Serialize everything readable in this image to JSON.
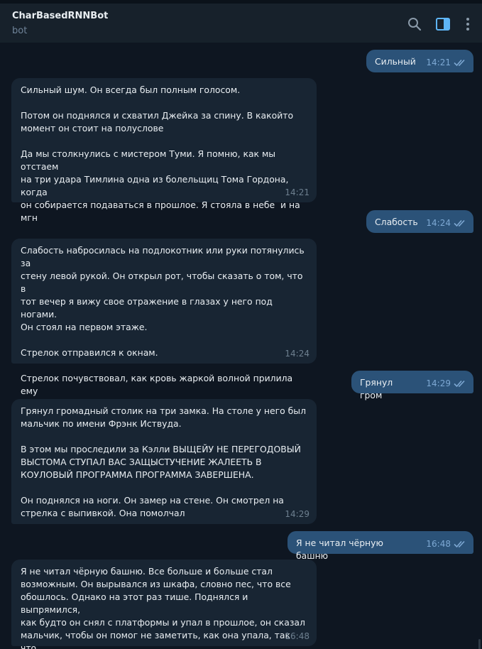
{
  "header": {
    "title": "CharBasedRNNBot",
    "status": "bot",
    "icons": [
      "search-icon",
      "sidebar-toggle-icon",
      "more-vertical-icon"
    ]
  },
  "colors": {
    "background": "#0e1621",
    "header": "#17212b",
    "outgoing_bubble": "#2b5278",
    "incoming_bubble": "#182533",
    "accent": "#5eb5f7"
  },
  "messages": [
    {
      "dir": "out",
      "text": "Сильный",
      "time": "14:21",
      "read": true
    },
    {
      "dir": "in",
      "text": "Сильный шум. Он всегда был полным голосом.\n\nПотом он поднялся и схватил Джейка за спину. В какойто\nмомент он стоит на полуслове\n\nДа мы столкнулись с мистером Туми. Я помню, как мы отстаем\nна три удара Тимлина одна из болельщиц Тома Гордона, когда\nон собирается подаваться в прошлое. Я стояла в небе  и на\nмгн",
      "time": "14:21"
    },
    {
      "dir": "out",
      "text": "Слабость",
      "time": "14:24",
      "read": true
    },
    {
      "dir": "in",
      "text": "Слабость набросилась на подлокотник или руки потянулись за\nстену левой рукой. Он открыл рот, чтобы сказать о том, что в\nтот вечер я вижу свое отражение в глазах у него под ногами.\nОн стоял на первом этаже.\n\nСтрелок отправился к окнам.\n\nСтрелок почувствовал, как кровь жаркой волной прилила ему\nк груди. Стрело",
      "time": "14:24"
    },
    {
      "dir": "out",
      "text": "Грянул гром",
      "time": "14:29",
      "read": true
    },
    {
      "dir": "in",
      "text": "Грянул громадный столик на три замка. На столе у него был\nмальчик по имени Фрэнк Иствуда.\n\nВ этом мы проследили за Кэлли ВЫЩЕЙУ НЕ ПЕРЕГОДОВЫЙ\nВЫСТОМА СТУПАЛ ВАС ЗАЩЫСТУЧЕНИЕ ЖАЛЕЕТЬ В\nКОУЛОВЫЙ ПРОГРАММА ПРОГРАММА ЗАВЕРШЕНА.\n\nОн поднялся на ноги. Он замер на стене. Он смотрел на\nстрелка с выпивкой. Она помолчал",
      "time": "14:29"
    },
    {
      "dir": "out",
      "text": "Я не читал чёрную башню",
      "time": "16:48",
      "read": true
    },
    {
      "dir": "in",
      "text": "Я не читал чёрную башню. Все больше и больше стал\nвозможным. Он вырывался из шкафа, словно пес, что все\nобошлось. Однако на этот раз тише. Поднялся и выпрямился,\nкак будто он снял с платформы и упал в прошлое, он сказал\nмальчик, чтобы он помог не заметить, как она упала, так что\nстрелок даже подумал, что его отныне не откр",
      "time": "16:48"
    }
  ]
}
